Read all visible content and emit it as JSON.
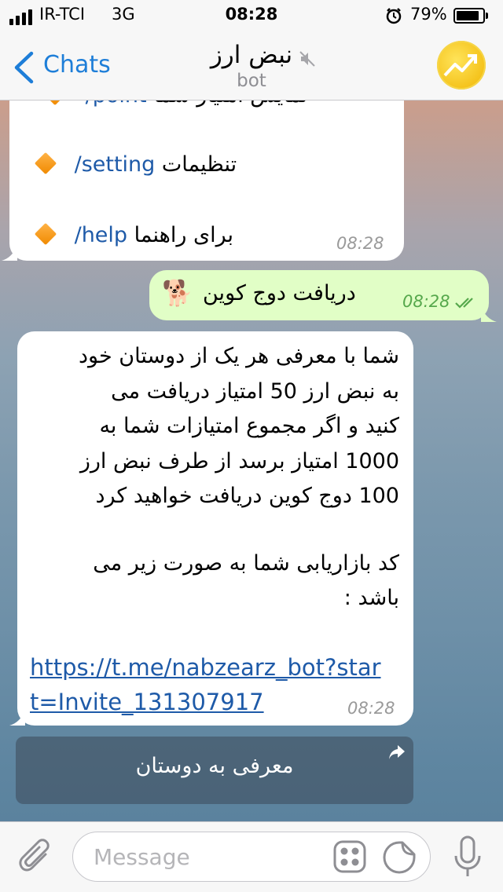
{
  "status": {
    "carrier": "IR-TCI",
    "network": "3G",
    "time": "08:28",
    "battery": "79%"
  },
  "nav": {
    "back_label": "Chats",
    "title": "نبض ارز",
    "subtitle": "bot"
  },
  "messages": {
    "menu": {
      "partial_line_text": "نمایش امتیاز شما",
      "partial_cmd": "/point",
      "items": [
        {
          "cmd": "/setting",
          "text": "تنظیمات"
        },
        {
          "cmd": "/help",
          "text": "برای راهنما"
        }
      ],
      "time": "08:28"
    },
    "outgoing": {
      "text": "دریافت دوج کوین",
      "emoji": "🐕",
      "time": "08:28"
    },
    "referral": {
      "lines": [
        "شما با معرفی هر یک از دوستان خود",
        "به نبض ارز 50 امتیاز دریافت می",
        "کنید و اگر مجموع امتیازات شما به",
        "1000 امتیاز برسد از طرف نبض ارز",
        "100 دوج کوین دریافت خواهید کرد"
      ],
      "lines2": [
        "کد بازاریابی شما به صورت زیر می",
        "باشد :"
      ],
      "link_line1": "https://t.me/nabzearz_bot?star",
      "link_line2": "t=Invite_131307917",
      "time": "08:28"
    }
  },
  "inline_button": {
    "label": "معرفی به دوستان"
  },
  "composer": {
    "placeholder": "Message"
  }
}
